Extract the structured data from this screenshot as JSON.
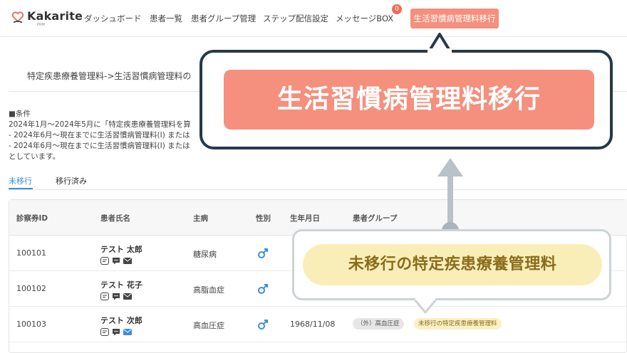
{
  "header": {
    "logo": "Kakarite",
    "logo_sub": "PRM",
    "nav": [
      "ダッシュボード",
      "患者一覧",
      "患者グループ管理",
      "ステップ配信設定",
      "メッセージBOX"
    ],
    "message_badge": "0",
    "action_button": "生活習慣病管理料移行"
  },
  "page": {
    "title": "特定疾患療養管理料->生活習慣病管理料の",
    "conditions": [
      "■条件",
      "2024年1月〜2024年5月に「特定疾患療養管理料を算",
      "- 2024年6月〜現在までに生活習慣病管理料(I) または",
      "- 2024年6月〜現在までに生活習慣病管理料(I) または",
      "としています。"
    ]
  },
  "tabs": [
    "未移行",
    "移行済み"
  ],
  "table": {
    "headers": [
      "診察券ID",
      "患者氏名",
      "主病",
      "性別",
      "生年月日",
      "患者グループ"
    ],
    "rows": [
      {
        "id": "100101",
        "name": "テスト 太郎",
        "disease": "糖尿病",
        "dob": ""
      },
      {
        "id": "100102",
        "name": "テスト 花子",
        "disease": "高脂血症",
        "dob": ""
      },
      {
        "id": "100103",
        "name": "テスト 次郎",
        "disease": "高血圧症",
        "dob": "1968/11/08",
        "tags": [
          "（外）高血圧症",
          "未移行の特定疾患療養管理料"
        ]
      }
    ]
  },
  "callouts": {
    "big": "生活習慣病管理料移行",
    "small": "未移行の特定疾患療養管理料"
  },
  "colors": {
    "accent": "#f4907d",
    "navy": "#25394a",
    "tab_blue": "#3a8fd8",
    "tag_yellow": "#fbefc4"
  }
}
